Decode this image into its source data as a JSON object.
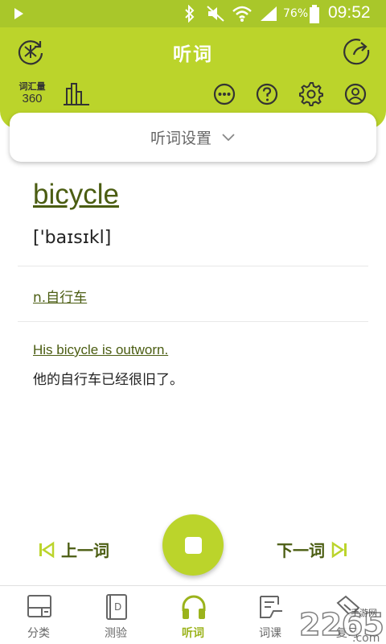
{
  "status_bar": {
    "battery_percent": "76%",
    "time": "09:52"
  },
  "header": {
    "title": "听词",
    "vocab_label": "词汇量",
    "vocab_count": "360"
  },
  "settings": {
    "label": "听词设置"
  },
  "word": {
    "text": "bicycle",
    "phonetic": "['baɪsɪkl]",
    "meaning": "n.自行车",
    "example_en": "His bicycle is outworn.",
    "example_zh": "他的自行车已经很旧了。"
  },
  "controls": {
    "prev_label": "上一词",
    "next_label": "下一词"
  },
  "tabs": [
    {
      "label": "分类",
      "icon": "category-icon"
    },
    {
      "label": "测验",
      "icon": "quiz-book-icon"
    },
    {
      "label": "听词",
      "icon": "headphones-icon",
      "active": true
    },
    {
      "label": "词课",
      "icon": "lesson-icon"
    },
    {
      "label": "复习",
      "icon": "review-icon"
    }
  ],
  "watermark": {
    "text": "2265",
    "suffix": ".com",
    "sub": "手游网"
  },
  "colors": {
    "accent": "#bbd42b",
    "status_bar": "#a9c72a",
    "text_dark_green": "#4b5d12",
    "tab_active": "#9bb31c"
  }
}
